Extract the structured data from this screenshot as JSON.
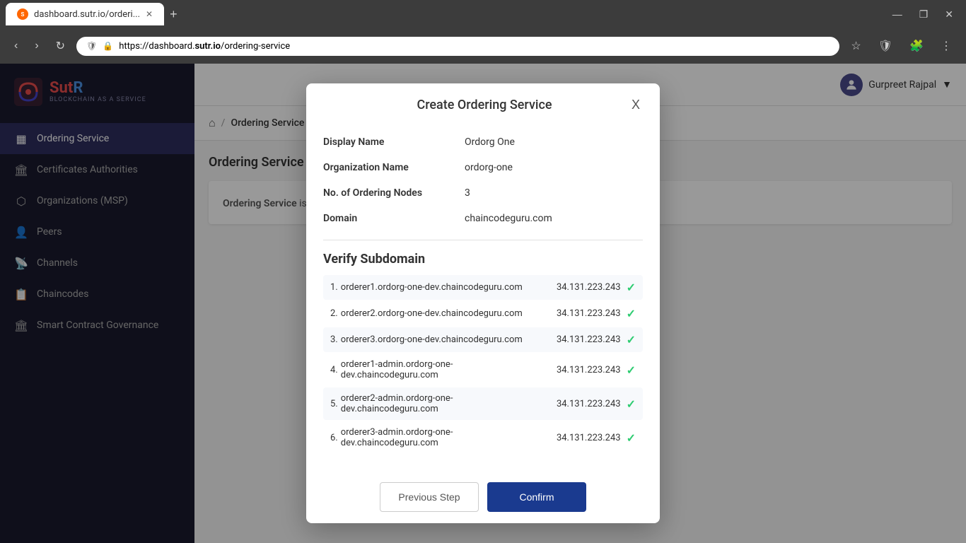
{
  "browser": {
    "tab_title": "dashboard.sutr.io/orderi...",
    "url": "https://dashboard.sutr.io/ordering-service",
    "url_domain": "https://dashboard.",
    "url_path": "sutr.io",
    "url_rest": "/ordering-service",
    "new_tab_label": "+",
    "minimize": "—",
    "maximize": "❐",
    "close": "✕"
  },
  "app": {
    "logo": {
      "brand": "SutR",
      "subtitle": "BLOCKCHAIN AS A SERVICE"
    },
    "user": {
      "name": "Gurpreet Rajpal",
      "avatar": "👤"
    },
    "nav": [
      {
        "id": "ordering",
        "label": "Ordering Service",
        "icon": "▦",
        "active": true
      },
      {
        "id": "ca",
        "label": "Certificates Authorities",
        "icon": "🏛"
      },
      {
        "id": "orgs",
        "label": "Organizations (MSP)",
        "icon": "⬡"
      },
      {
        "id": "peers",
        "label": "Peers",
        "icon": "👤"
      },
      {
        "id": "channels",
        "label": "Channels",
        "icon": "📡"
      },
      {
        "id": "chaincodes",
        "label": "Chaincodes",
        "icon": "📋"
      },
      {
        "id": "scg",
        "label": "Smart Contract Governance",
        "icon": "🏛"
      }
    ],
    "breadcrumb": {
      "home": "⌂",
      "separator": "/",
      "current": "Ordering Service"
    },
    "page_title": "Ordering Service"
  },
  "modal": {
    "title": "Create Ordering Service",
    "close_label": "X",
    "fields": [
      {
        "label": "Display Name",
        "value": "Ordorg One"
      },
      {
        "label": "Organization Name",
        "value": "ordorg-one"
      },
      {
        "label": "No. of Ordering Nodes",
        "value": "3"
      },
      {
        "label": "Domain",
        "value": "chaincodeguru.com"
      }
    ],
    "verify_title": "Verify Subdomain",
    "subdomains": [
      {
        "num": "1.",
        "name": "orderer1.ordorg-one-dev.chaincodeguru.com",
        "ip": "34.131.223.243",
        "verified": true
      },
      {
        "num": "2.",
        "name": "orderer2.ordorg-one-dev.chaincodeguru.com",
        "ip": "34.131.223.243",
        "verified": true
      },
      {
        "num": "3.",
        "name": "orderer3.ordorg-one-dev.chaincodeguru.com",
        "ip": "34.131.223.243",
        "verified": true
      },
      {
        "num": "4.",
        "name": "orderer1-admin.ordorg-one-dev.chaincodeguru.com",
        "ip": "34.131.223.243",
        "verified": true
      },
      {
        "num": "5.",
        "name": "orderer2-admin.ordorg-one-dev.chaincodeguru.com",
        "ip": "34.131.223.243",
        "verified": true
      },
      {
        "num": "6.",
        "name": "orderer3-admin.ordorg-one-dev.chaincodeguru.com",
        "ip": "34.131.223.243",
        "verified": true
      }
    ],
    "prev_btn": "Previous Step",
    "confirm_btn": "Confirm"
  }
}
